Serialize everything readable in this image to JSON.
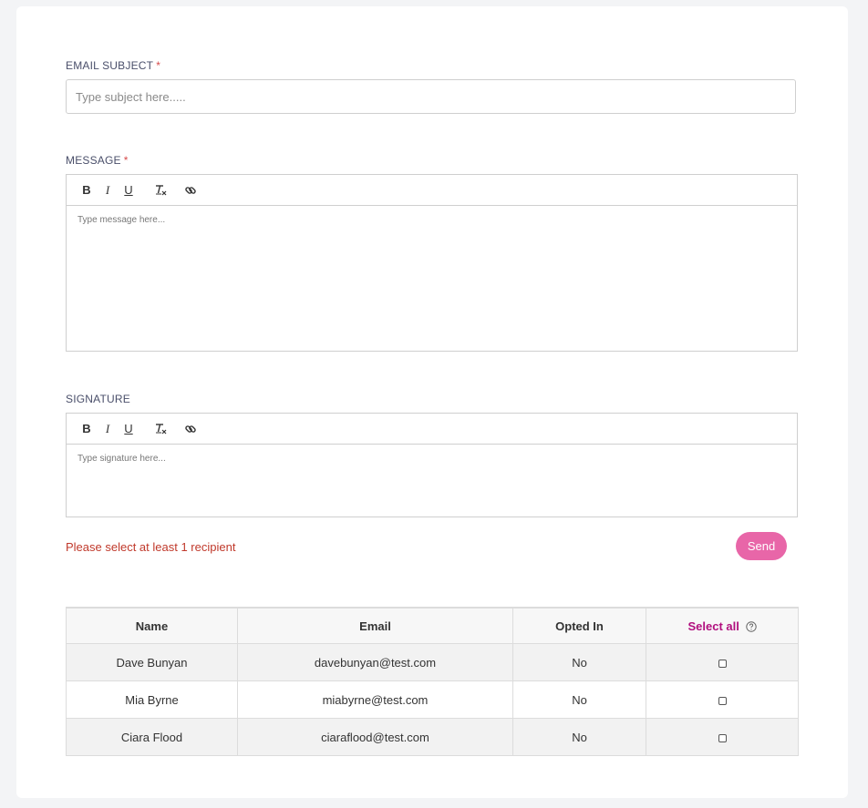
{
  "form": {
    "subject": {
      "label": "EMAIL SUBJECT",
      "required_mark": "*",
      "placeholder": "Type subject here.....",
      "value": ""
    },
    "message": {
      "label": "MESSAGE",
      "required_mark": "*",
      "placeholder": "Type message here..."
    },
    "signature": {
      "label": "SIGNATURE",
      "placeholder": "Type signature here..."
    },
    "toolbar": {
      "bold": "B",
      "italic": "I",
      "underline": "U",
      "clean": "Tx",
      "link": "link-icon"
    },
    "error": "Please select at least 1 recipient",
    "send_label": "Send"
  },
  "table": {
    "headers": {
      "name": "Name",
      "email": "Email",
      "opted_in": "Opted In",
      "select_all": "Select all"
    },
    "rows": [
      {
        "name": "Dave Bunyan",
        "email": "davebunyan@test.com",
        "opted_in": "No",
        "selected": false
      },
      {
        "name": "Mia Byrne",
        "email": "miabyrne@test.com",
        "opted_in": "No",
        "selected": false
      },
      {
        "name": "Ciara Flood",
        "email": "ciaraflood@test.com",
        "opted_in": "No",
        "selected": false
      }
    ]
  },
  "colors": {
    "accent": "#e866a8",
    "error": "#c0392b",
    "select_all": "#b10f7e"
  }
}
